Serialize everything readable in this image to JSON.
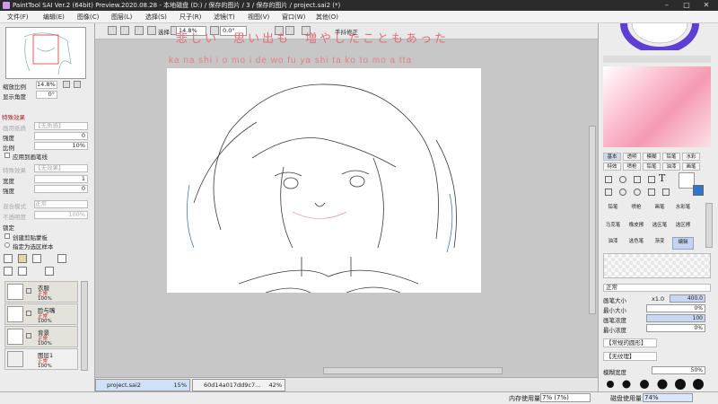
{
  "window": {
    "title": "PaintTool SAI Ver.2 (64bit) Preview.2020.08.28 - 本地磁盘 (D:) / 保存的图片 / 3 / 保存的图片 / project.sai2 (*)"
  },
  "menu": [
    "文件(F)",
    "编辑(E)",
    "图像(C)",
    "图层(L)",
    "选择(S)",
    "尺子(R)",
    "滤镜(T)",
    "视图(V)",
    "窗口(W)",
    "其他(O)"
  ],
  "toolbar": {
    "select_label": "选择",
    "zoom_value": "14.8%",
    "angle_value": "0.0°",
    "stabilizer_label": "手抖修正"
  },
  "navigator": {
    "zoom_label": "缩放比例",
    "zoom_value": "14.8%",
    "angle_label": "显示角度",
    "angle_value": "0°"
  },
  "effects": {
    "header": "特殊效果",
    "texture_label": "画用纸质",
    "texture_value": "【无质感】",
    "strength_label": "强度",
    "strength_value": "0",
    "scale_label": "比例",
    "scale_value": "10%",
    "apply_to_stroke": "应用到画笔线",
    "effect_label": "特殊效果",
    "effect_value": "【无效果】",
    "width_label": "宽度",
    "width_value": "1",
    "intensity_label": "强度",
    "intensity_value": "0"
  },
  "layer_props": {
    "blend_label": "混合模式",
    "blend_value": "正常",
    "opacity_label": "不透明度",
    "opacity_value": "100%",
    "lock_label": "锁定",
    "clip_label": "创建剪贴蒙板",
    "selection_source": "指定为选区样本"
  },
  "layers": [
    {
      "name": "衣服",
      "mode": "正常",
      "opacity": "100%"
    },
    {
      "name": "脸与嘴",
      "mode": "正常",
      "opacity": "100%"
    },
    {
      "name": "背景",
      "mode": "正常",
      "opacity": "100%"
    },
    {
      "name": "图层1",
      "mode": "正常",
      "opacity": "100%"
    }
  ],
  "lyrics": {
    "line1": "悲しい　思い出も　増やしたこともあった",
    "line2": "ka na shi i o mo i de wo fu ya shi ta ko to mo a tta"
  },
  "files": [
    {
      "name": "project.sai2",
      "zoom": "15%"
    },
    {
      "name": "60d14a017dd9c7...",
      "zoom": "42%"
    }
  ],
  "status": {
    "memory_label": "内存使用量",
    "memory_value": "7% (7%)",
    "disk_label": "磁盘使用量",
    "disk_value": "74%"
  },
  "color_tabs": [
    "基本",
    "透明",
    "模糊",
    "铅笔",
    "水彩",
    "马克"
  ],
  "tool_sets": {
    "row1": [
      "特效",
      "喷枪",
      "铅笔",
      "油漆",
      "画笔"
    ],
    "row2": [
      "铅笔",
      "喷枪",
      "画笔",
      "水彩笔"
    ],
    "row3": [
      "马克笔",
      "橡皮擦",
      "选区笔",
      "选区擦"
    ],
    "row4": [
      "油漆",
      "选色笔",
      "渐变",
      "编辑"
    ]
  },
  "brush": {
    "mode": "正常",
    "size_label": "画笔大小",
    "size_mult": "x1.0",
    "size_value": "400.0",
    "min_size_label": "最小大小",
    "min_size_value": "0%",
    "density_label": "画笔浓度",
    "density_value": "100",
    "min_density_label": "最小浓度",
    "min_density_value": "0%",
    "shape_value": "【常规的圆形】",
    "texture_value": "【无纹理】",
    "blend_label": "模糊宽度",
    "blend_value": "50%"
  },
  "colors": {
    "accent": "#c9e",
    "lyric": "#e26e7c",
    "mode_red": "#c2202d"
  }
}
